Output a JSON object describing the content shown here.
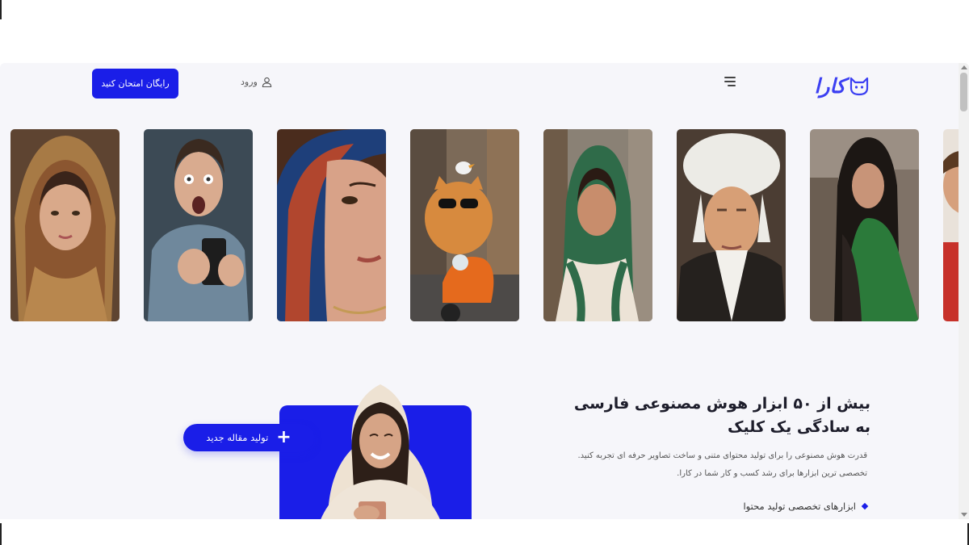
{
  "header": {
    "logo_text": "کارا",
    "menu_icon": "hamburger-icon",
    "login_label": "ورود",
    "cta_label": "رایگان امتحان کنید"
  },
  "gallery": {
    "items": [
      {
        "subject": "woman-in-paisley-headscarf"
      },
      {
        "subject": "shocked-man-holding-phone"
      },
      {
        "subject": "woman-close-up-blue-scarf"
      },
      {
        "subject": "cat-with-sunglasses-on-scooter"
      },
      {
        "subject": "woman-in-green-scarf-street"
      },
      {
        "subject": "man-in-white-turban"
      },
      {
        "subject": "woman-in-green-shawl-street"
      },
      {
        "subject": "partially-visible-child"
      }
    ]
  },
  "hero": {
    "title": "بیش از ۵۰ ابزار هوش مصنوعی فارسی به سادگی یک کلیک",
    "desc_line1": "قدرت هوش مصنوعی را برای تولید محتوای متنی و ساخت تصاویر حرفه ای تجربه کنید.",
    "desc_line2": "تخصصی ترین ابزارها برای رشد کسب و کار شما در کارا.",
    "feature_1": "ابزارهای تخصصی تولید محتوا",
    "new_article_label": "تولید مقاله جدید",
    "new_article_icon": "+"
  },
  "colors": {
    "brand": "#1a1ee8",
    "background": "#f6f6fa",
    "text": "#1d1d2b"
  }
}
